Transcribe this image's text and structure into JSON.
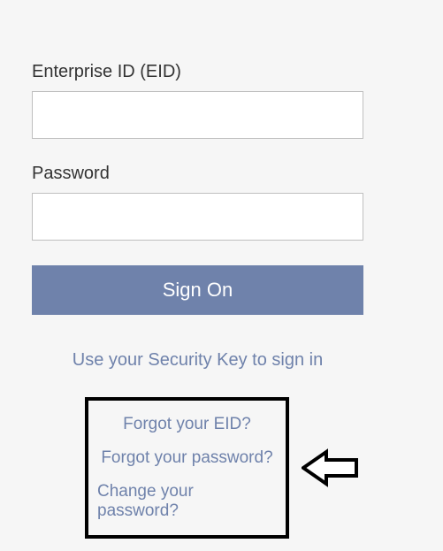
{
  "form": {
    "eid_label": "Enterprise ID (EID)",
    "eid_value": "",
    "password_label": "Password",
    "password_value": "",
    "signon_label": "Sign On"
  },
  "links": {
    "security_key": "Use your Security Key to sign in",
    "forgot_eid": "Forgot your EID?",
    "forgot_password": "Forgot your password?",
    "change_password": "Change your password?"
  },
  "colors": {
    "accent": "#6f82ab",
    "text": "#333333",
    "border": "#bfbfbf",
    "background": "#f6f6f6",
    "highlight_border": "#000000"
  }
}
